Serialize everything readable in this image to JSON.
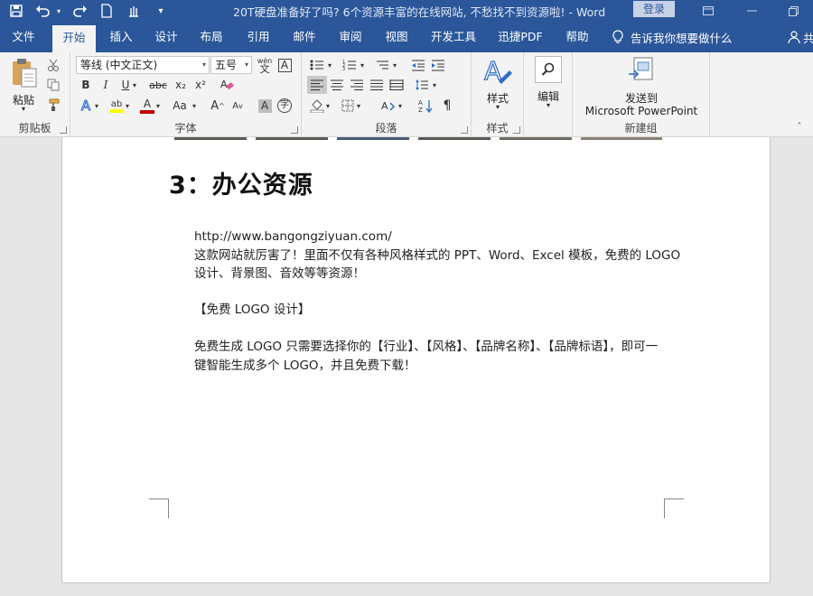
{
  "titlebar": {
    "title": "20T硬盘准备好了吗? 6个资源丰富的在线网站, 不愁找不到资源啦!  -  Word",
    "login": "登录",
    "qat": {
      "save_icon": "save-icon",
      "undo_icon": "undo-icon",
      "redo_icon": "redo-icon"
    }
  },
  "tabs": [
    "文件",
    "开始",
    "插入",
    "设计",
    "布局",
    "引用",
    "邮件",
    "审阅",
    "视图",
    "开发工具",
    "迅捷PDF",
    "帮助"
  ],
  "tell_me": "告诉我你想要做什么",
  "share": "共",
  "ribbon": {
    "clipboard": {
      "paste": "粘贴",
      "label": "剪贴板"
    },
    "font": {
      "font_name": "等线 (中文正文)",
      "font_size": "五号",
      "label": "字体",
      "wen": "wén",
      "bold": "B",
      "italic": "I",
      "underline": "U",
      "strike": "abc",
      "sub": "x₂",
      "sup": "x²",
      "grow": "A",
      "shrink": "A",
      "aa": "Aa",
      "char": "字",
      "font_color": "#c00000",
      "highlight_color": "#ffff00"
    },
    "paragraph": {
      "label": "段落"
    },
    "styles": {
      "button": "样式",
      "label": "样式"
    },
    "editing": {
      "button": "编辑"
    },
    "newgroup": {
      "line1": "发送到",
      "line2": "Microsoft PowerPoint",
      "label": "新建组"
    }
  },
  "document": {
    "heading": "3：办公资源",
    "url": "http://www.bangongziyuan.com/",
    "desc_line1": "这款网站就厉害了！里面不仅有各种风格样式的 PPT、Word、Excel 模板，免费的 LOGO",
    "desc_line2": "设计、背景图、音效等等资源！",
    "section": "【免费 LOGO 设计】",
    "logo_line1": "免费生成 LOGO 只需要选择你的【行业】、【风格】、【品牌名称】、【品牌标语】，即可一",
    "logo_line2": "键智能生成多个 LOGO，并且免费下载！"
  }
}
